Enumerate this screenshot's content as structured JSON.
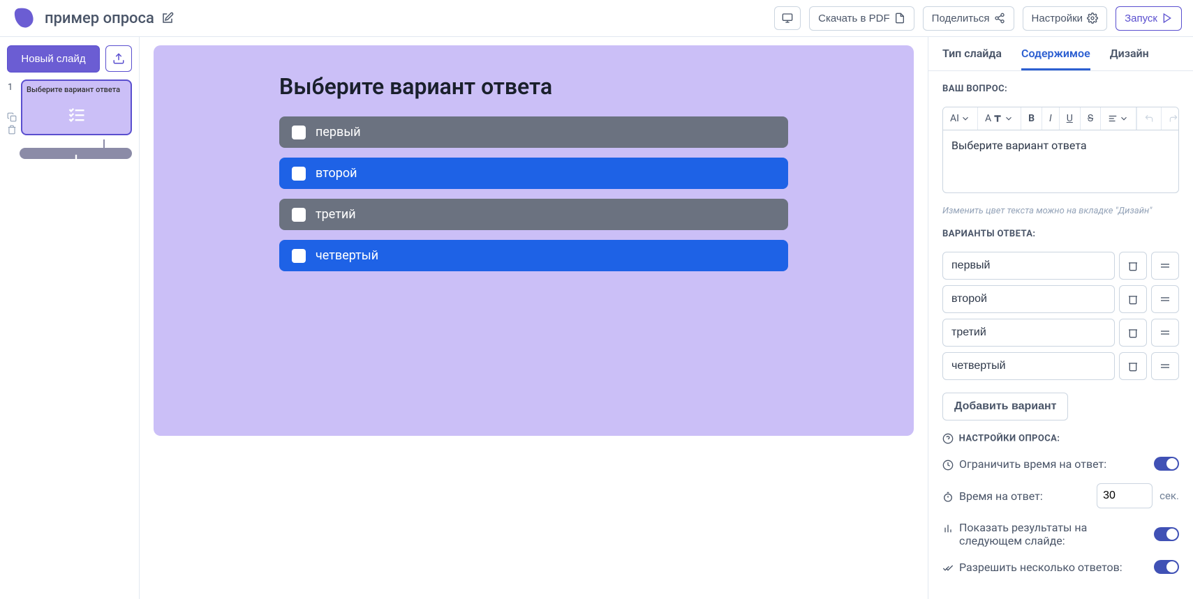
{
  "colors": {
    "accent": "#5a4fcf",
    "blue": "#1e62e6",
    "gray": "#6b7280"
  },
  "header": {
    "title": "пример опроса",
    "download_pdf": "Скачать в PDF",
    "share": "Поделиться",
    "settings": "Настройки",
    "launch": "Запуск"
  },
  "sidebar": {
    "new_slide": "Новый слайд",
    "slides": [
      {
        "num": "1",
        "title": "Выберите вариант ответа",
        "active": true
      }
    ]
  },
  "canvas": {
    "question": "Выберите вариант ответа",
    "options": [
      {
        "text": "первый",
        "style": "gray"
      },
      {
        "text": "второй",
        "style": "blue"
      },
      {
        "text": "третий",
        "style": "gray"
      },
      {
        "text": "четвертый",
        "style": "blue"
      }
    ]
  },
  "panel": {
    "tabs": {
      "type": "Тип слайда",
      "content": "Содержимое",
      "design": "Дизайн"
    },
    "question_label": "ВАШ ВОПРОС:",
    "question_value": "Выберите вариант ответа",
    "question_hint": "Изменить цвет текста можно на вкладке \"Дизайн\"",
    "answers_label": "ВАРИАНТЫ ОТВЕТА:",
    "answers": [
      "первый",
      "второй",
      "третий",
      "четвертый"
    ],
    "add_variant": "Добавить вариант",
    "settings_label": "НАСТРОЙКИ ОПРОСА:",
    "limit_time": "Ограничить время на ответ:",
    "time_label": "Время на ответ:",
    "time_value": "30",
    "time_suffix": "сек.",
    "show_results": "Показать результаты на следующем слайде:",
    "allow_multiple": "Разрешить несколько ответов:",
    "toolbar": {
      "ai": "AI",
      "af": "A"
    }
  }
}
